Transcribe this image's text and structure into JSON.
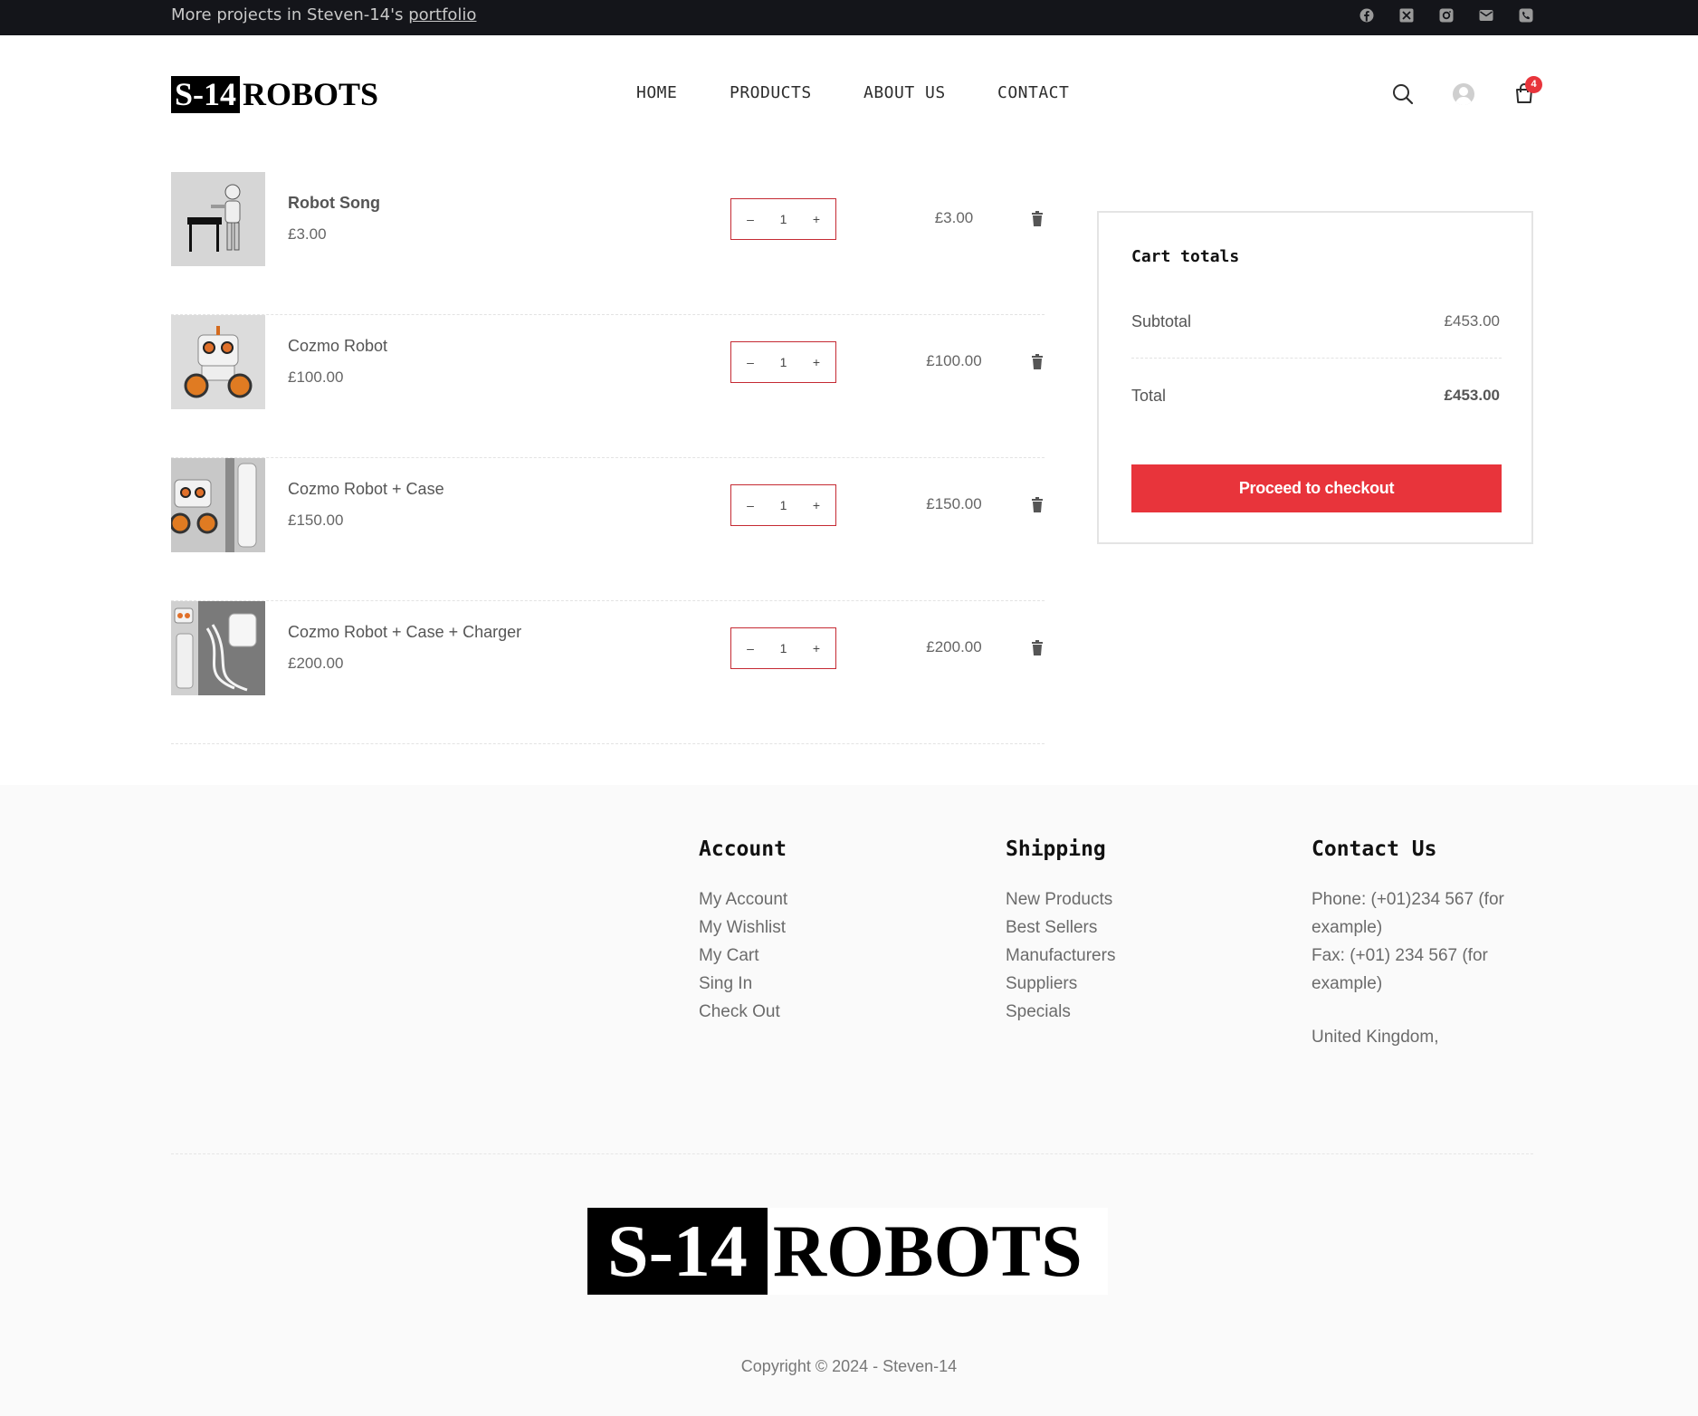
{
  "topbar": {
    "text": "More projects in Steven-14's ",
    "link": "portfolio",
    "social_icons": [
      "facebook-icon",
      "x-icon",
      "instagram-icon",
      "mail-icon",
      "phone-icon"
    ]
  },
  "header": {
    "logo_box": "S-14",
    "logo_rest": "ROBOTS",
    "nav": [
      "HOME",
      "PRODUCTS",
      "ABOUT US",
      "CONTACT"
    ],
    "icons": [
      "search-icon",
      "user-icon",
      "cart-icon"
    ],
    "cart_count": "4"
  },
  "cart": {
    "minus": "–",
    "plus": "+",
    "items": [
      {
        "name": "Robot Song",
        "price": "£3.00",
        "qty": "1",
        "total": "£3.00"
      },
      {
        "name": "Cozmo Robot",
        "price": "£100.00",
        "qty": "1",
        "total": "£100.00"
      },
      {
        "name": "Cozmo Robot + Case",
        "price": "£150.00",
        "qty": "1",
        "total": "£150.00"
      },
      {
        "name": "Cozmo Robot + Case + Charger",
        "price": "£200.00",
        "qty": "1",
        "total": "£200.00"
      }
    ]
  },
  "totals": {
    "title": "Cart totals",
    "subtotal_label": "Subtotal",
    "subtotal_value": "£453.00",
    "total_label": "Total",
    "total_value": "£453.00",
    "checkout": "Proceed to checkout"
  },
  "footer": {
    "account": {
      "title": "Account",
      "items": [
        "My Account",
        "My Wishlist",
        "My Cart",
        "Sing In",
        "Check Out"
      ]
    },
    "shipping": {
      "title": "Shipping",
      "items": [
        "New Products",
        "Best Sellers",
        "Manufacturers",
        "Suppliers",
        "Specials"
      ]
    },
    "contact": {
      "title": "Contact Us",
      "phone": "Phone: (+01)234 567 (for example)",
      "fax": "Fax: (+01) 234 567 (for example)",
      "address": "United Kingdom,"
    },
    "copyright": "Copyright © 2024 - Steven-14"
  },
  "colors": {
    "accent": "#e8343b",
    "topbar": "#14151a",
    "footer_bg": "#fafafa"
  }
}
